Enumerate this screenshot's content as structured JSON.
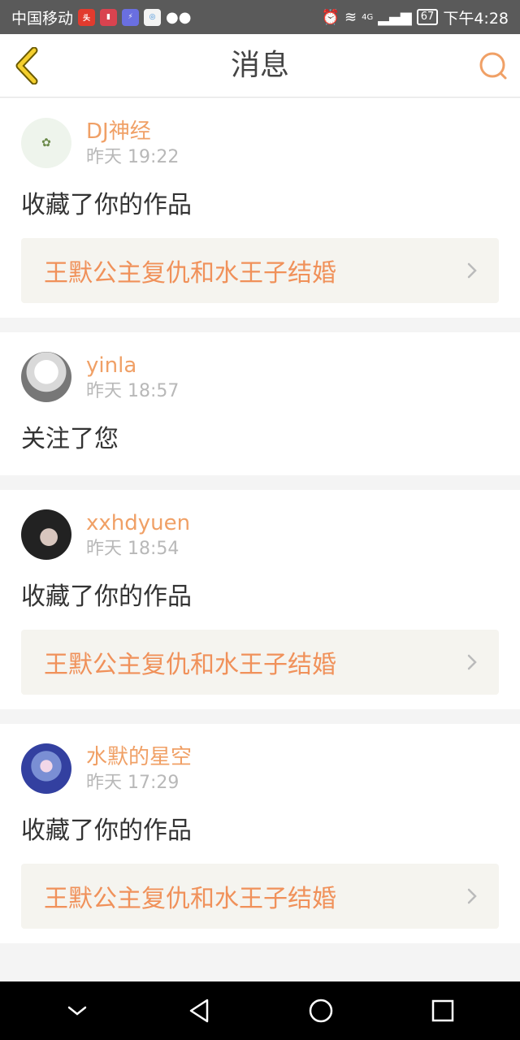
{
  "status_bar": {
    "carrier": "中国移动",
    "network": "4G",
    "battery": "67",
    "time": "下午4:28",
    "app_icons": [
      "toutiao-icon",
      "book-icon",
      "flash-icon",
      "browser-icon",
      "wechat-icon"
    ]
  },
  "header": {
    "title": "消息"
  },
  "colors": {
    "accent": "#f0a066",
    "link_text": "#f0915a",
    "link_bg": "#f5f4ef"
  },
  "messages": [
    {
      "username": "DJ神经",
      "time": "昨天 19:22",
      "action": "收藏了你的作品",
      "work_title": "王默公主复仇和水王子结婚"
    },
    {
      "username": "yinla",
      "time": "昨天 18:57",
      "action": "关注了您"
    },
    {
      "username": "xxhdyuen",
      "time": "昨天 18:54",
      "action": "收藏了你的作品",
      "work_title": "王默公主复仇和水王子结婚"
    },
    {
      "username": "水默的星空",
      "time": "昨天 17:29",
      "action": "收藏了你的作品",
      "work_title": "王默公主复仇和水王子结婚"
    }
  ]
}
